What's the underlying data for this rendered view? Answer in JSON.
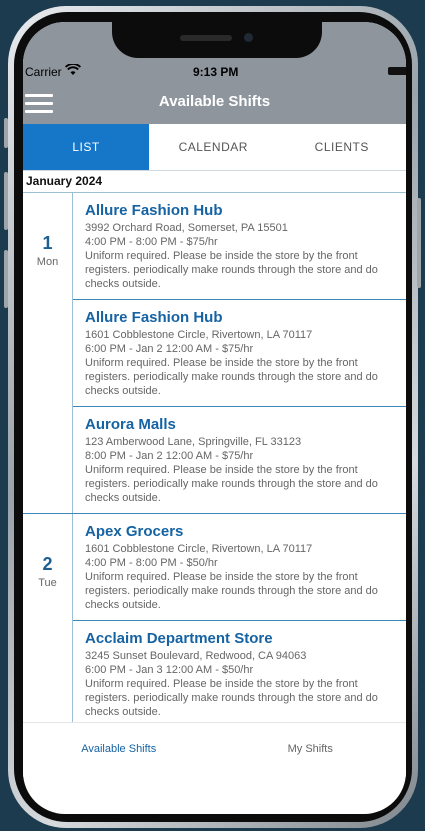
{
  "status_bar": {
    "carrier": "Carrier",
    "time": "9:13 PM"
  },
  "header": {
    "title": "Available Shifts"
  },
  "tabs": [
    {
      "label": "LIST",
      "active": true
    },
    {
      "label": "CALENDAR",
      "active": false
    },
    {
      "label": "CLIENTS",
      "active": false
    }
  ],
  "month_header": "January 2024",
  "days": [
    {
      "num": "1",
      "name": "Mon",
      "shifts": [
        {
          "title": "Allure Fashion Hub",
          "address": "3992 Orchard Road, Somerset, PA 15501",
          "time": "4:00 PM - 8:00 PM - $75/hr",
          "notes": "Uniform required. Please be inside the store by the front registers. periodically make rounds through the store and do checks outside."
        },
        {
          "title": "Allure Fashion Hub",
          "address": "1601 Cobblestone Circle, Rivertown, LA 70117",
          "time": "6:00 PM - Jan 2 12:00 AM - $75/hr",
          "notes": "Uniform required. Please be inside the store by the front registers. periodically make rounds through the store and do checks outside."
        },
        {
          "title": "Aurora Malls",
          "address": "123 Amberwood Lane, Springville, FL 33123",
          "time": "8:00 PM - Jan 2 12:00 AM - $75/hr",
          "notes": "Uniform required. Please be inside the store by the front registers. periodically make rounds through the store and do checks outside."
        }
      ]
    },
    {
      "num": "2",
      "name": "Tue",
      "shifts": [
        {
          "title": "Apex Grocers",
          "address": "1601 Cobblestone Circle, Rivertown, LA 70117",
          "time": "4:00 PM - 8:00 PM - $50/hr",
          "notes": "Uniform required. Please be inside the store by the front registers. periodically make rounds through the store and do checks outside."
        },
        {
          "title": "Acclaim Department Store",
          "address": "3245 Sunset Boulevard, Redwood, CA 94063",
          "time": "6:00 PM - Jan 3 12:00 AM - $50/hr",
          "notes": "Uniform required. Please be inside the store by the front registers. periodically make rounds through the store and do checks outside."
        }
      ]
    }
  ],
  "bottom_tabs": [
    {
      "label": "Available Shifts",
      "active": true
    },
    {
      "label": "My Shifts",
      "active": false
    }
  ],
  "colors": {
    "accent": "#1677c8",
    "header": "#8e959d",
    "title_text": "#1563a3",
    "background": "#1d3b4f"
  }
}
